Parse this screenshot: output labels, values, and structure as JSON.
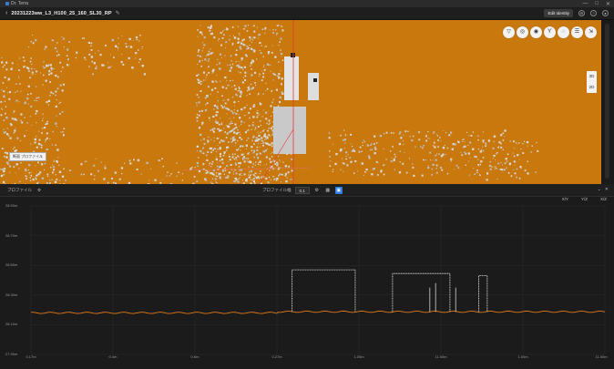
{
  "window": {
    "app_name": "Dr. Terra",
    "controls": [
      "—",
      "□",
      "✕"
    ]
  },
  "header": {
    "back_icon": "chevron-left-icon",
    "title": "20231223ww_L3_H100_25_160_SL30_RP",
    "edit_icon": "pencil-icon",
    "verify_label": "Edit Identity",
    "icons": [
      "gear-icon",
      "help-icon",
      "user-icon"
    ]
  },
  "viewport": {
    "background_color": "#c8780d",
    "toolbar": [
      {
        "name": "filter-icon",
        "glyph": "▽"
      },
      {
        "name": "layers-icon",
        "glyph": "◎"
      },
      {
        "name": "location-icon",
        "glyph": "◉"
      },
      {
        "name": "marker-icon",
        "glyph": "ϒ"
      },
      {
        "name": "camera-icon",
        "glyph": "◌"
      },
      {
        "name": "list-icon",
        "glyph": "☰"
      },
      {
        "name": "export-icon",
        "glyph": "⇲"
      }
    ],
    "zoom": {
      "top": "3D",
      "bottom": "2D"
    },
    "scale_label": "断面 プロファイル"
  },
  "graph_header": {
    "left_label": "プロファイル",
    "left_icon": "settings-icon",
    "center_label": "プロファイル幅",
    "center_value": "0.1",
    "center_icons": [
      "settings-icon",
      "chart-icon",
      "graph-icon"
    ],
    "right_icons": [
      "collapse-icon",
      "close-icon"
    ]
  },
  "graph_sub": [
    "X/Y",
    "Y/Z",
    "X/Z"
  ],
  "chart_data": {
    "type": "line",
    "y_ticks": [
      "28.90m",
      "28.70m",
      "28.50m",
      "28.30m",
      "28.10m",
      "27.90m"
    ],
    "x_ticks": [
      "0.17m",
      "0.4m",
      "0.6m",
      "0.27m",
      "1.05m",
      "11.00m",
      "1.00m",
      "11.00m"
    ],
    "line_color": "#e07b1a",
    "marker_color": "#eeeeee",
    "ylim": [
      27.9,
      28.9
    ],
    "ground_level": 28.18,
    "raised_segments": [
      {
        "x": [
          0.455,
          0.565
        ],
        "y": 28.47
      },
      {
        "x": [
          0.63,
          0.73
        ],
        "y": 28.445
      },
      {
        "x": [
          0.78,
          0.795
        ],
        "y": 28.43
      }
    ],
    "grid": true
  }
}
